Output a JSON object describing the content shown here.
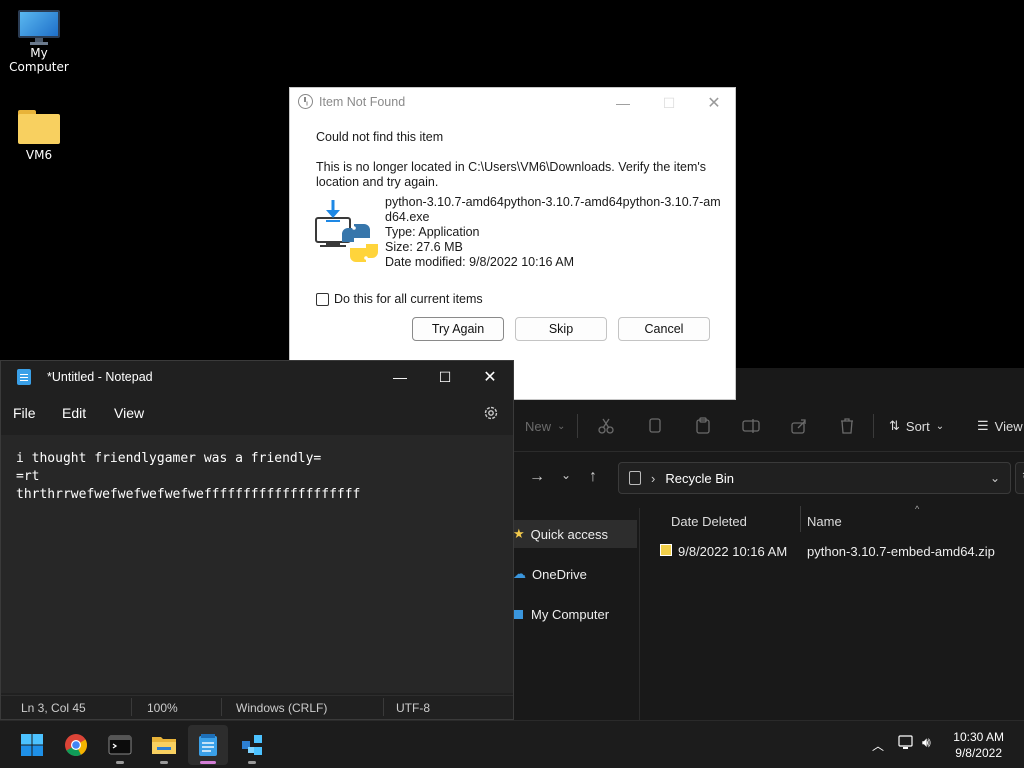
{
  "desktop": {
    "icons": [
      {
        "label": "My Computer"
      },
      {
        "label": "VM6"
      }
    ]
  },
  "dialog": {
    "title": "Item Not Found",
    "heading": "Could not find this item",
    "message_line1": "This is no longer located in C:\\Users\\VM6\\Downloads. Verify the item's",
    "message_line2": "location and try again.",
    "file_name_line1": "python-3.10.7-amd64python-3.10.7-amd64python-3.10.7-am",
    "file_name_line2": "d64.exe",
    "file_type": "Type: Application",
    "file_size": "Size: 27.6 MB",
    "file_date": "Date modified: 9/8/2022 10:16 AM",
    "checkbox_label": "Do this for all current items",
    "checkbox_checked": false,
    "buttons": {
      "try_again": "Try Again",
      "skip": "Skip",
      "cancel": "Cancel"
    }
  },
  "notepad": {
    "title": "*Untitled - Notepad",
    "menu": [
      "File",
      "Edit",
      "View"
    ],
    "lines": [
      "i thought friendlygamer was a friendly=",
      "=rt",
      "thrthrrwefwefwefwefwefweffffffffffffffffffff"
    ],
    "status": {
      "position": "Ln 3, Col 45",
      "zoom": "100%",
      "line_ending": "Windows (CRLF)",
      "encoding": "UTF-8"
    }
  },
  "explorer": {
    "toolbar": {
      "new_label": "New",
      "sort_label": "Sort",
      "view_label": "View"
    },
    "address": "Recycle Bin",
    "sidebar": [
      "Quick access",
      "OneDrive",
      "My Computer"
    ],
    "columns": {
      "date_deleted": "Date Deleted",
      "name": "Name"
    },
    "rows": [
      {
        "date_deleted": "9/8/2022 10:16 AM",
        "name": "python-3.10.7-embed-amd64.zip"
      }
    ]
  },
  "taskbar": {
    "time": "10:30 AM",
    "date": "9/8/2022",
    "apps": [
      "start-icon",
      "chrome-icon",
      "terminal-icon",
      "file-explorer-icon",
      "notepad-icon",
      "network-app-icon"
    ]
  },
  "colors": {
    "accent": "#0067c0",
    "python_blue": "#3776ab",
    "python_yellow": "#ffd43b"
  }
}
